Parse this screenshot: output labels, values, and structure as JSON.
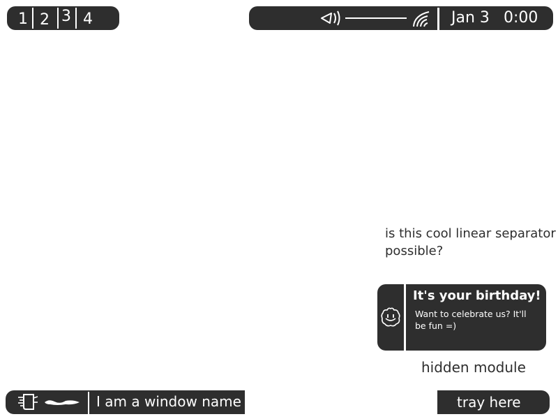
{
  "colors": {
    "bar_bg": "#2e2e2e",
    "fg": "#ffffff",
    "text": "#2e2e2e"
  },
  "workspaces": [
    {
      "label": "1"
    },
    {
      "label": "2"
    },
    {
      "label": "3"
    },
    {
      "label": "4"
    }
  ],
  "statusbar": {
    "volume_icon": "speaker-icon",
    "wifi_icon": "wifi-icon",
    "date": "Jan 3",
    "time": "0:00"
  },
  "separator_note": "is this cool linear separator possible?",
  "notification": {
    "icon": "smiley-icon",
    "title": "It's your birthday!",
    "body": "Want to celebrate us? It'll be fun =)"
  },
  "hidden_module": "hidden module",
  "taskbar": {
    "app_icon": "app-icon",
    "window_name": "I am a window name"
  },
  "tray": {
    "label": "tray here"
  }
}
